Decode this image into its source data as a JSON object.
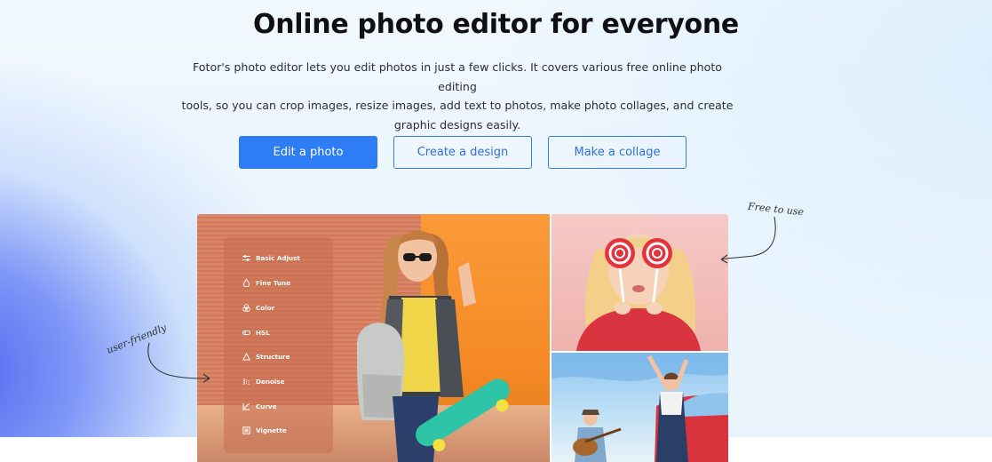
{
  "hero": {
    "title": "Online photo editor for everyone",
    "subtitle_lines": [
      "Fotor's photo editor lets you edit photos in just a few clicks. It covers various free online photo editing",
      "tools, so you can crop images, resize images, add text to photos, make photo collages, and create",
      "graphic designs easily."
    ]
  },
  "buttons": {
    "edit": "Edit a photo",
    "design": "Create a design",
    "collage": "Make a collage"
  },
  "editor_menu": {
    "items": [
      {
        "label": "Basic Adjust",
        "icon": "sliders-icon"
      },
      {
        "label": "Fine Tune",
        "icon": "droplet-icon"
      },
      {
        "label": "Color",
        "icon": "color-circles-icon"
      },
      {
        "label": "HSL",
        "icon": "hsl-icon"
      },
      {
        "label": "Structure",
        "icon": "triangle-icon"
      },
      {
        "label": "Denoise",
        "icon": "denoise-icon"
      },
      {
        "label": "Curve",
        "icon": "curve-icon"
      },
      {
        "label": "Vignette",
        "icon": "vignette-icon"
      }
    ]
  },
  "annotations": {
    "free": "Free to use",
    "user": "user-friendly"
  },
  "colors": {
    "primary": "#2f7df6",
    "outline": "#3a7cec",
    "title": "#0f0f14"
  }
}
